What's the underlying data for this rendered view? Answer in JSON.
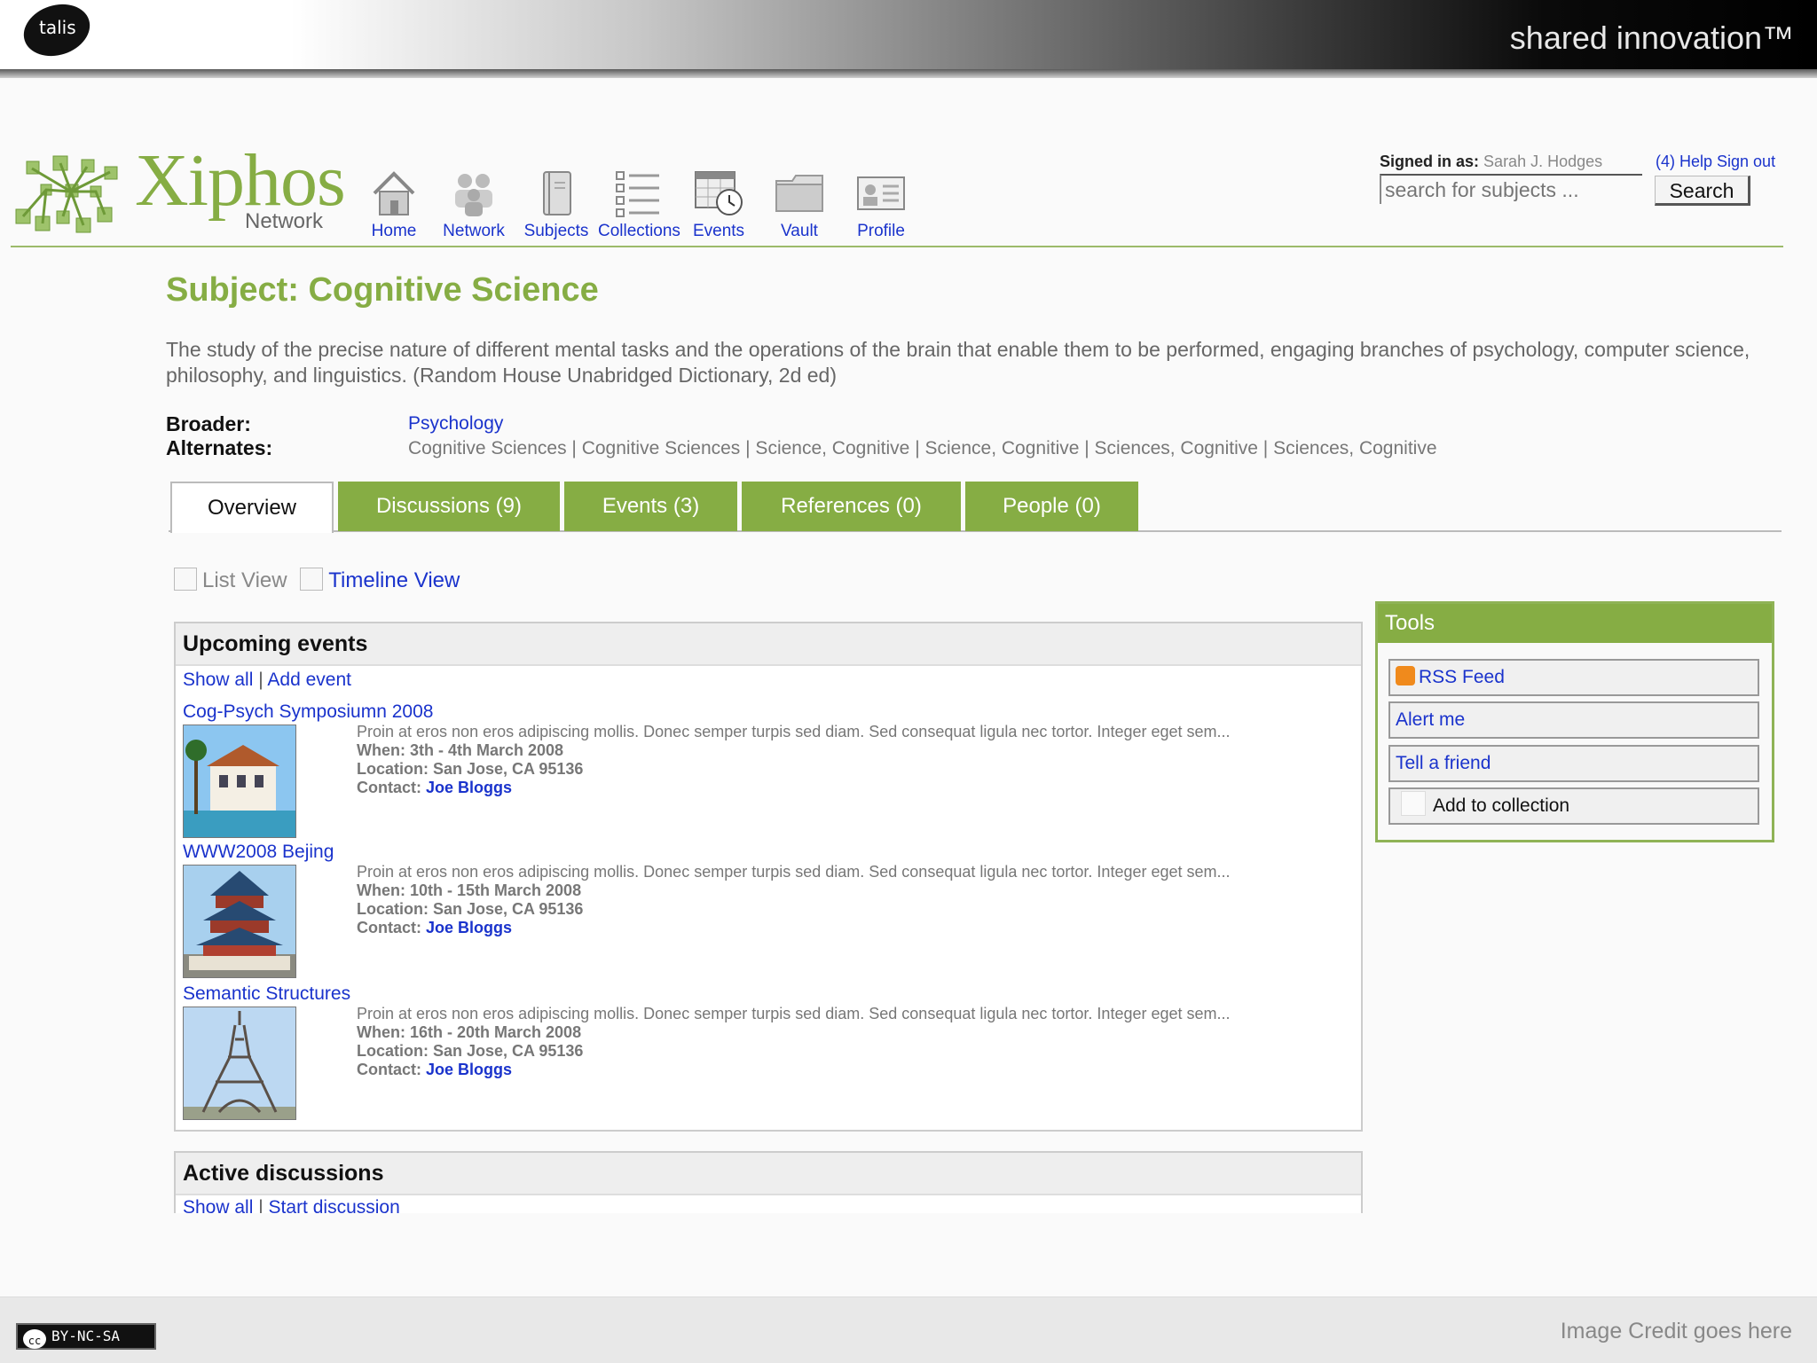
{
  "banner": {
    "logo_text": "talis",
    "tagline": "shared innovation™"
  },
  "app": {
    "brand": "Xiphos",
    "brand_sub": "Network"
  },
  "nav": [
    {
      "label": "Home",
      "icon": "home-icon"
    },
    {
      "label": "Network",
      "icon": "people-icon"
    },
    {
      "label": "Subjects",
      "icon": "book-icon"
    },
    {
      "label": "Collections",
      "icon": "list-icon"
    },
    {
      "label": "Events",
      "icon": "calendar-clock-icon"
    },
    {
      "label": "Vault",
      "icon": "folder-icon"
    },
    {
      "label": "Profile",
      "icon": "profile-card-icon"
    }
  ],
  "account": {
    "signed_in_label": "Signed in as:",
    "user": "Sarah J. Hodges",
    "links": "(4) Help Sign out",
    "search_placeholder": "search for subjects ...",
    "search_button": "Search"
  },
  "subject": {
    "title": "Subject: Cognitive Science",
    "description": "The study of the precise nature of different mental tasks and the operations of the brain that enable them to be performed, engaging branches of psychology, computer science, philosophy, and linguistics. (Random House Unabridged Dictionary, 2d ed)",
    "broader_label": "Broader:",
    "broader_value": "Psychology",
    "alternates_label": "Alternates:",
    "alternates_value": "Cognitive Sciences | Cognitive Sciences | Science, Cognitive | Science, Cognitive | Sciences, Cognitive | Sciences, Cognitive"
  },
  "tabs": [
    {
      "label": "Overview",
      "active": true
    },
    {
      "label": "Discussions (9)"
    },
    {
      "label": "Events (3)"
    },
    {
      "label": "References (0)"
    },
    {
      "label": "People (0)"
    }
  ],
  "views": {
    "list": "List View",
    "timeline": "Timeline View"
  },
  "upcoming": {
    "title": "Upcoming events",
    "show_all": "Show all",
    "add": "Add event",
    "events": [
      {
        "title": "Cog-Psych Symposiumn 2008",
        "desc": "Proin at eros non eros adipiscing mollis. Donec semper turpis sed diam. Sed consequat ligula nec tortor. Integer eget sem...",
        "when_label": "When:",
        "when": "3th - 4th March 2008",
        "location_label": "Location:",
        "location": "San Jose, CA 95136",
        "contact_label": "Contact:",
        "contact": "Joe Bloggs"
      },
      {
        "title": "WWW2008 Bejing",
        "desc": "Proin at eros non eros adipiscing mollis. Donec semper turpis sed diam. Sed consequat ligula nec tortor. Integer eget sem...",
        "when_label": "When:",
        "when": "10th - 15th March 2008",
        "location_label": "Location:",
        "location": "San Jose, CA 95136",
        "contact_label": "Contact:",
        "contact": "Joe Bloggs"
      },
      {
        "title": "Semantic Structures",
        "desc": "Proin at eros non eros adipiscing mollis. Donec semper turpis sed diam. Sed consequat ligula nec tortor. Integer eget sem...",
        "when_label": "When:",
        "when": "16th - 20th March 2008",
        "location_label": "Location:",
        "location": "San Jose, CA 95136",
        "contact_label": "Contact:",
        "contact": "Joe Bloggs"
      }
    ]
  },
  "discussions": {
    "title": "Active discussions",
    "show_all": "Show all",
    "start": "Start discussion"
  },
  "tools": {
    "title": "Tools",
    "items": [
      "RSS Feed",
      "Alert me",
      "Tell a friend",
      "Add to collection"
    ]
  },
  "footer": {
    "license": "BY-NC-SA",
    "cc": "cc",
    "credit": "Image Credit goes here"
  },
  "colors": {
    "accent_green": "#86ad44",
    "link_blue": "#1a33cc"
  }
}
